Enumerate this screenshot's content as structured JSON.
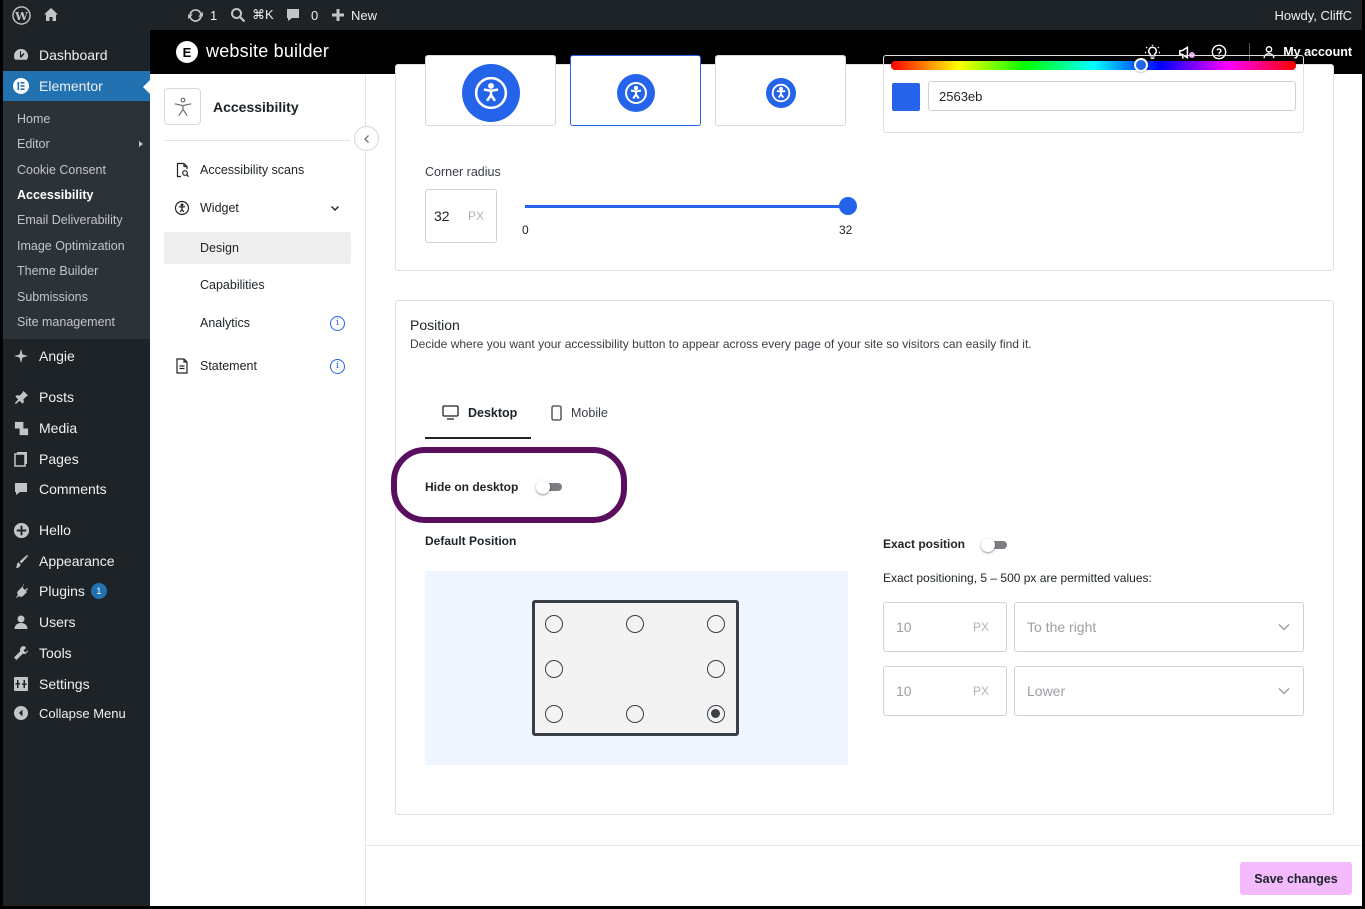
{
  "admin_bar": {
    "updates_count": "1",
    "search_shortcut": "⌘K",
    "comments_count": "0",
    "new_label": "New",
    "howdy": "Howdy, CliffC"
  },
  "wp_menu": {
    "dashboard": "Dashboard",
    "elementor": "Elementor",
    "submenu": [
      "Home",
      "Editor",
      "Cookie Consent",
      "Accessibility",
      "Email Deliverability",
      "Image Optimization",
      "Theme Builder",
      "Submissions",
      "Site management"
    ],
    "angie": "Angie",
    "posts": "Posts",
    "media": "Media",
    "pages": "Pages",
    "comments": "Comments",
    "hello": "Hello",
    "appearance": "Appearance",
    "plugins": "Plugins",
    "plugins_badge": "1",
    "users": "Users",
    "tools": "Tools",
    "settings": "Settings",
    "collapse": "Collapse Menu"
  },
  "topbar": {
    "title": "website builder",
    "my_account": "My account"
  },
  "side_nav": {
    "title": "Accessibility",
    "scans": "Accessibility scans",
    "widget": "Widget",
    "design": "Design",
    "capabilities": "Capabilities",
    "analytics": "Analytics",
    "statement": "Statement"
  },
  "design": {
    "color_hex": "2563eb",
    "corner_radius_label": "Corner radius",
    "corner_radius_value": "32",
    "corner_radius_unit": "PX",
    "slider_min": "0",
    "slider_max": "32",
    "slider_value": 32
  },
  "position": {
    "title": "Position",
    "description": "Decide where you want your accessibility button to appear across every page of your site so visitors can easily find it.",
    "tab_desktop": "Desktop",
    "tab_mobile": "Mobile",
    "hide_label": "Hide on desktop",
    "default_position_label": "Default Position",
    "exact_position_label": "Exact position",
    "exact_hint": "Exact positioning, 5 – 500 px are permitted values:",
    "horizontal_value": "10",
    "horizontal_unit": "PX",
    "horizontal_select": "To the right",
    "vertical_value": "10",
    "vertical_unit": "PX",
    "vertical_select": "Lower",
    "selected_position": "bottom-right"
  },
  "save_label": "Save changes",
  "colors": {
    "accent": "#2563eb",
    "wp_active": "#2271b1",
    "highlight": "#5a0f5e",
    "save_button": "#f3bafd"
  }
}
